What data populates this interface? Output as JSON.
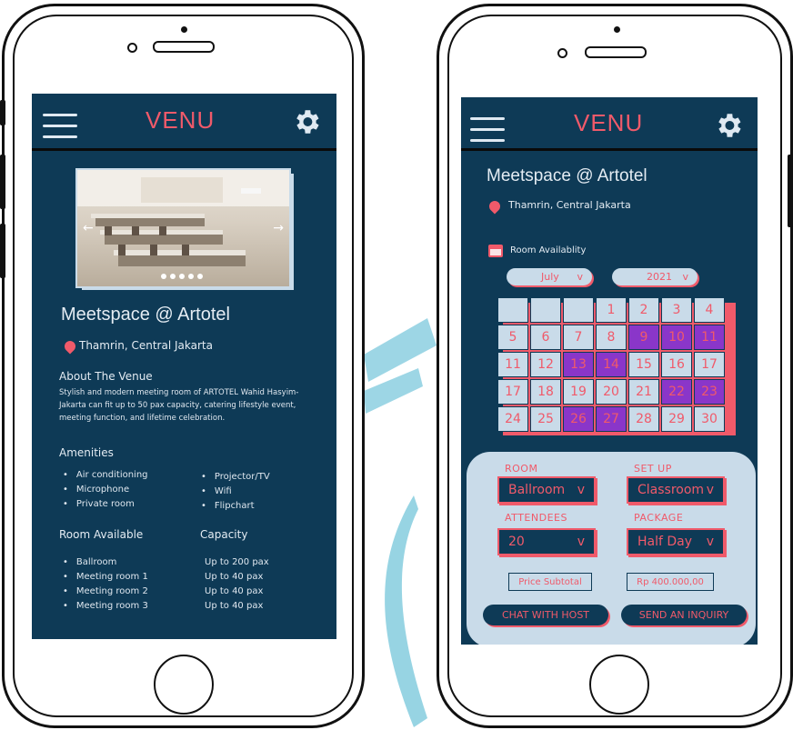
{
  "app": {
    "logo": "VENU"
  },
  "venue": {
    "name": "Meetspace  @ Artotel",
    "location": "Thamrin, Central Jakarta",
    "about_title": "About The Venue",
    "about_text": "Stylish and modern meeting room of ARTOTEL Wahid Hasyim-Jakarta can fit up to 50 pax capacity, catering lifestyle event, meeting function, and lifetime celebration.",
    "amenities_title": "Amenities",
    "amenities_left": [
      "Air conditioning",
      "Microphone",
      "Private room"
    ],
    "amenities_right": [
      "Projector/TV",
      "Wifi",
      "Flipchart"
    ],
    "rooms_title": "Room Available",
    "capacity_title": "Capacity",
    "rooms": [
      "Ballroom",
      "Meeting room 1",
      "Meeting room 2",
      "Meeting room 3"
    ],
    "capacities": [
      "Up to 200 pax",
      "Up to 40 pax",
      "Up to 40 pax",
      "Up to 40 pax"
    ],
    "carousel": {
      "active": 1,
      "count": 5
    }
  },
  "booking": {
    "title": "Meetspace  @ Artotel",
    "location": "Thamrin, Central Jakarta",
    "availability_label": "Room Availablity",
    "month": "July",
    "year": "2021",
    "dropdown_chevron": "v",
    "calendar": [
      [
        "",
        "",
        "",
        "1",
        "2",
        "3",
        "4"
      ],
      [
        "5",
        "6",
        "7",
        "8",
        "9",
        "10",
        "11"
      ],
      [
        "11",
        "12",
        "13",
        "14",
        "15",
        "16",
        "17"
      ],
      [
        "17",
        "18",
        "19",
        "20",
        "21",
        "22",
        "23"
      ],
      [
        "24",
        "25",
        "26",
        "27",
        "28",
        "29",
        "30"
      ]
    ],
    "highlighted": [
      "9",
      "10",
      "11b",
      "13",
      "14",
      "22",
      "23",
      "26",
      "27"
    ],
    "room_label": "ROOM",
    "room_value": "Ballroom",
    "setup_label": "SET UP",
    "setup_value": "Classroom",
    "attendees_label": "ATTENDEES",
    "attendees_value": "20",
    "package_label": "PACKAGE",
    "package_value": "Half Day",
    "price_label": "Price Subtotal",
    "price_value": "Rp 400.000,00",
    "chat_button": "CHAT WITH HOST",
    "inquiry_button": "SEND AN INQUIRY"
  },
  "colors": {
    "screen": "#0e3a56",
    "accent": "#f05a6a",
    "highlight": "#8a36c9",
    "panel": "#c9dbe9"
  }
}
